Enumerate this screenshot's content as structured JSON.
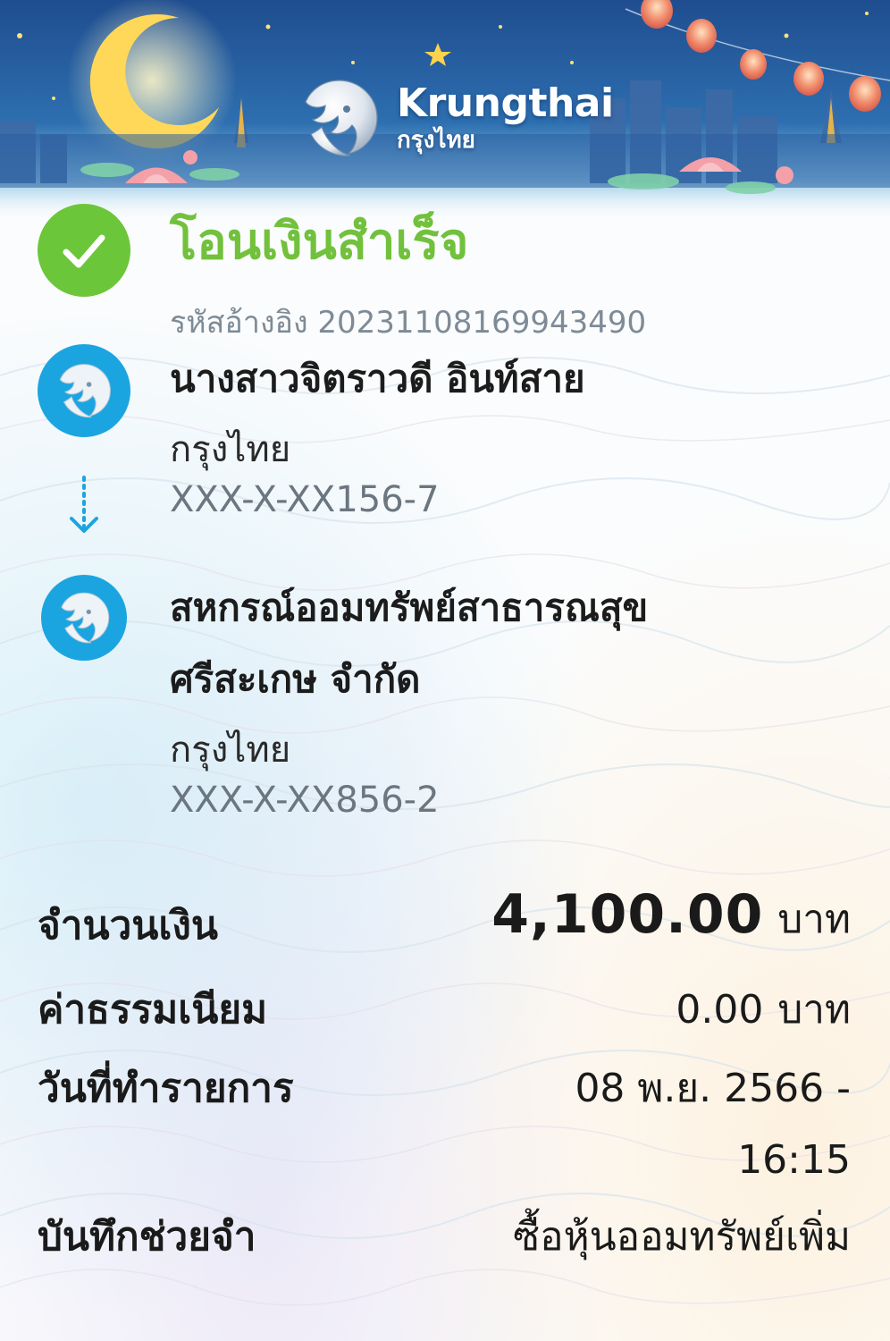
{
  "bank": {
    "name_en": "Krungthai",
    "name_th": "กรุงไทย"
  },
  "status": {
    "title": "โอนเงินสำเร็จ",
    "reference_label": "รหัสอ้างอิง",
    "reference_number": "20231108169943490"
  },
  "sender": {
    "name": "นางสาวจิตราวดี อินท์สาย",
    "bank": "กรุงไทย",
    "account": "XXX-X-XX156-7"
  },
  "receiver": {
    "name_line1": "สหกรณ์ออมทรัพย์สาธารณสุข",
    "name_line2": "ศรีสะเกษ จำกัด",
    "bank": "กรุงไทย",
    "account": "XXX-X-XX856-2"
  },
  "details": {
    "amount_label": "จำนวนเงิน",
    "amount_value": "4,100.00",
    "amount_unit": "บาท",
    "fee_label": "ค่าธรรมเนียม",
    "fee_value": "0.00",
    "fee_unit": "บาท",
    "date_label": "วันที่ทำรายการ",
    "date_value_line1": "08 พ.ย. 2566 -",
    "date_value_line2": "16:15",
    "memo_label": "บันทึกช่วยจำ",
    "memo_value": "ซื้อหุ้นออมทรัพย์เพิ่ม"
  },
  "colors": {
    "success_green": "#6cc63a",
    "title_green": "#72c13d",
    "krungthai_blue": "#1ba5e0",
    "banner_navy": "#1f3f78"
  },
  "icons": {
    "success": "check-icon",
    "transfer_direction": "arrow-down-icon",
    "bank_logo": "krungthai-bird-logo"
  }
}
